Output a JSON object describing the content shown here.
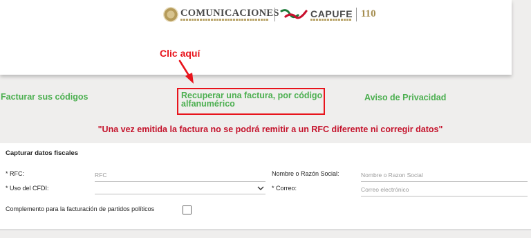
{
  "header": {
    "sct_title": "COMUNICACIONES",
    "capufe_title": "CAPUFE",
    "anniversary": "110"
  },
  "annotation": {
    "clic_text": "Clic aquí",
    "accent_color": "#e8141c"
  },
  "nav": {
    "facturar": "Facturar sus códigos",
    "recuperar": "Recuperar una factura, por código alfanumérico",
    "aviso": "Aviso de Privacidad",
    "link_color": "#4caf50"
  },
  "warning_text": "\"Una vez emitida la factura no se podrá remitir a un RFC diferente ni corregir datos\"",
  "form": {
    "section_title": "Capturar datos fiscales",
    "rfc_label": "* RFC:",
    "rfc_placeholder": "RFC",
    "uso_label": "* Uso del CFDI:",
    "uso_value": "",
    "nombre_label": "Nombre o Razón Social:",
    "nombre_placeholder": "Nombre o Razon Social",
    "correo_label": "* Correo:",
    "correo_placeholder": "Correo electrónico",
    "complemento_label": "Complemento para la facturación de partidos políticos",
    "complemento_checked": false
  },
  "icons": {
    "sct_seal": "mexico-seal-icon",
    "capufe_logo": "capufe-logo-icon",
    "arrow": "arrow-down-right-icon",
    "chevron": "chevron-down-icon"
  }
}
